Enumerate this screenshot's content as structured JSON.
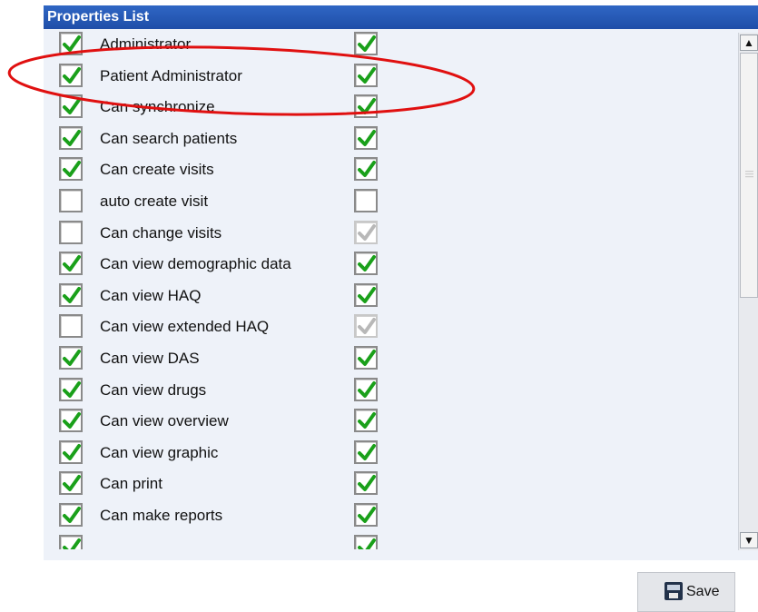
{
  "panel": {
    "title": "Properties List"
  },
  "properties": [
    {
      "label": "Administrator",
      "left": "checked",
      "right": "checked"
    },
    {
      "label": "Patient Administrator",
      "left": "checked",
      "right": "checked"
    },
    {
      "label": "Can synchronize",
      "left": "checked",
      "right": "checked"
    },
    {
      "label": "Can search patients",
      "left": "checked",
      "right": "checked"
    },
    {
      "label": "Can create visits",
      "left": "checked",
      "right": "checked"
    },
    {
      "label": "auto create visit",
      "left": "unchecked",
      "right": "unchecked"
    },
    {
      "label": "Can change visits",
      "left": "unchecked",
      "right": "disabled"
    },
    {
      "label": "Can view demographic data",
      "left": "checked",
      "right": "checked"
    },
    {
      "label": "Can view HAQ",
      "left": "checked",
      "right": "checked"
    },
    {
      "label": "Can view extended HAQ",
      "left": "unchecked",
      "right": "disabled"
    },
    {
      "label": "Can view DAS",
      "left": "checked",
      "right": "checked"
    },
    {
      "label": "Can view drugs",
      "left": "checked",
      "right": "checked"
    },
    {
      "label": "Can view overview",
      "left": "checked",
      "right": "checked"
    },
    {
      "label": "Can view graphic",
      "left": "checked",
      "right": "checked"
    },
    {
      "label": "Can print",
      "left": "checked",
      "right": "checked"
    },
    {
      "label": "Can make reports",
      "left": "checked",
      "right": "checked"
    },
    {
      "label": "",
      "left": "checked",
      "right": "checked"
    }
  ],
  "scrollbar": {
    "up_icon": "chevron-up-icon",
    "down_icon": "chevron-down-icon"
  },
  "save": {
    "label": "Save",
    "icon": "floppy-disk-icon"
  },
  "colors": {
    "title_bar": "#2f66c4",
    "check_green": "#1aa01a",
    "check_disabled": "#b8b8b8",
    "annotation_red": "#e01010"
  }
}
